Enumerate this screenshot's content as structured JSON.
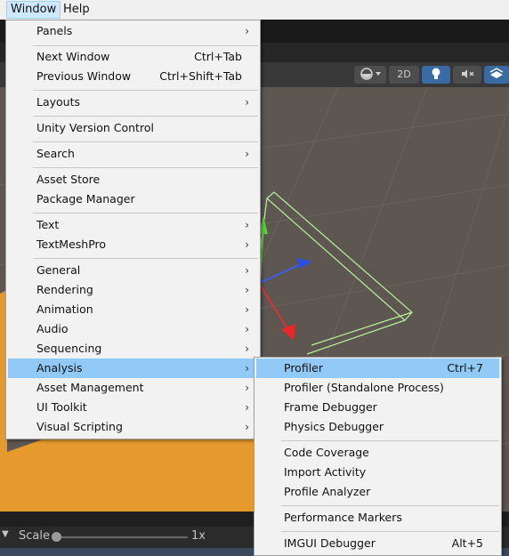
{
  "menubar": {
    "window": "Window",
    "help": "Help"
  },
  "window_menu": {
    "panels": "Panels",
    "next_window": "Next Window",
    "next_window_sc": "Ctrl+Tab",
    "previous_window": "Previous Window",
    "previous_window_sc": "Ctrl+Shift+Tab",
    "layouts": "Layouts",
    "unity_version_control": "Unity Version Control",
    "search": "Search",
    "asset_store": "Asset Store",
    "package_manager": "Package Manager",
    "text": "Text",
    "textmeshpro": "TextMeshPro",
    "general": "General",
    "rendering": "Rendering",
    "animation": "Animation",
    "audio": "Audio",
    "sequencing": "Sequencing",
    "analysis": "Analysis",
    "asset_management": "Asset Management",
    "ui_toolkit": "UI Toolkit",
    "visual_scripting": "Visual Scripting"
  },
  "analysis_menu": {
    "profiler": "Profiler",
    "profiler_sc": "Ctrl+7",
    "profiler_standalone": "Profiler (Standalone Process)",
    "frame_debugger": "Frame Debugger",
    "physics_debugger": "Physics Debugger",
    "code_coverage": "Code Coverage",
    "import_activity": "Import Activity",
    "profile_analyzer": "Profile Analyzer",
    "performance_markers": "Performance Markers",
    "imgui_debugger": "IMGUI Debugger",
    "imgui_debugger_sc": "Alt+5"
  },
  "toolbar": {
    "mode_2d": "2D"
  },
  "bottom": {
    "scale_label": "Scale",
    "scale_value": "1x"
  },
  "colors": {
    "highlight": "#91c9f7",
    "scene_bg": "#5d5651",
    "orange": "#e69a2e"
  }
}
